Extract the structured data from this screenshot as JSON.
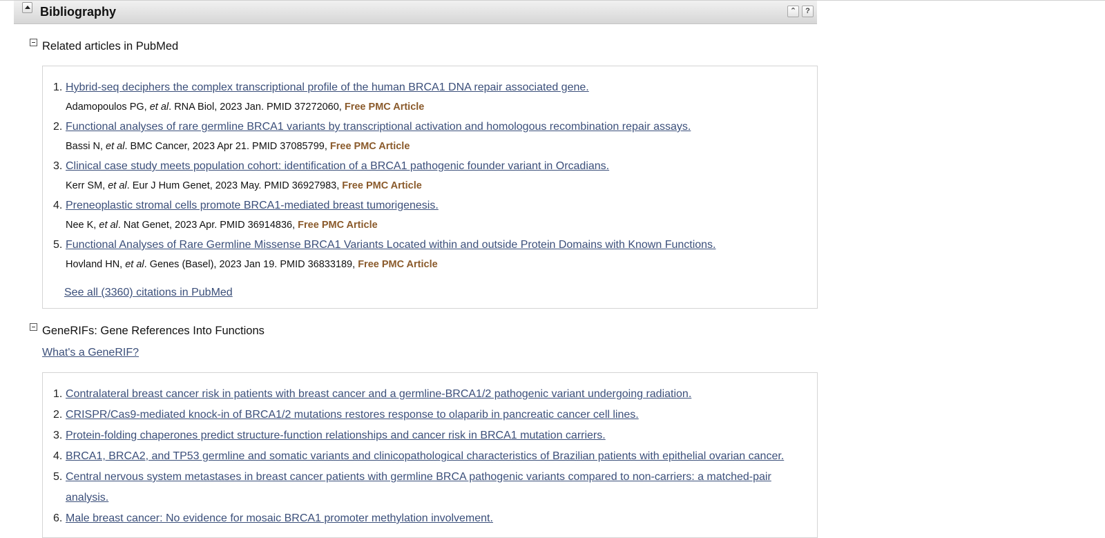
{
  "section": {
    "title": "Bibliography"
  },
  "pubmed": {
    "heading": "Related articles in PubMed",
    "articles": [
      {
        "num": "1.",
        "title": "Hybrid-seq deciphers the complex transcriptional profile of the human BRCA1 DNA repair associated gene.",
        "authors": "Adamopoulos PG,",
        "etal": "et al",
        "journal": ". RNA Biol, 2023 Jan. PMID 37272060,",
        "free": "Free PMC Article"
      },
      {
        "num": "2.",
        "title": "Functional analyses of rare germline BRCA1 variants by transcriptional activation and homologous recombination repair assays.",
        "authors": "Bassi N,",
        "etal": "et al",
        "journal": ". BMC Cancer, 2023 Apr 21. PMID 37085799,",
        "free": "Free PMC Article"
      },
      {
        "num": "3.",
        "title": "Clinical case study meets population cohort: identification of a BRCA1 pathogenic founder variant in Orcadians.",
        "authors": "Kerr SM,",
        "etal": "et al",
        "journal": ". Eur J Hum Genet, 2023 May. PMID 36927983,",
        "free": "Free PMC Article"
      },
      {
        "num": "4.",
        "title": "Preneoplastic stromal cells promote BRCA1-mediated breast tumorigenesis.",
        "authors": "Nee K,",
        "etal": "et al",
        "journal": ". Nat Genet, 2023 Apr. PMID 36914836,",
        "free": "Free PMC Article"
      },
      {
        "num": "5.",
        "title": "Functional Analyses of Rare Germline Missense BRCA1 Variants Located within and outside Protein Domains with Known Functions.",
        "authors": "Hovland HN,",
        "etal": "et al",
        "journal": ". Genes (Basel), 2023 Jan 19. PMID 36833189,",
        "free": "Free PMC Article"
      }
    ],
    "see_all": "See all (3360) citations in PubMed"
  },
  "generifs": {
    "heading": "GeneRIFs: Gene References Into Functions",
    "whats_link": "What's a GeneRIF?",
    "items": [
      {
        "num": "1.",
        "text": "Contralateral breast cancer risk in patients with breast cancer and a germline-BRCA1/2 pathogenic variant undergoing radiation."
      },
      {
        "num": "2.",
        "text": "CRISPR/Cas9-mediated knock-in of BRCA1/2 mutations restores response to olaparib in pancreatic cancer cell lines."
      },
      {
        "num": "3.",
        "text": "Protein-folding chaperones predict structure-function relationships and cancer risk in BRCA1 mutation carriers."
      },
      {
        "num": "4.",
        "text": "BRCA1, BRCA2, and TP53 germline and somatic variants and clinicopathological characteristics of Brazilian patients with epithelial ovarian cancer."
      },
      {
        "num": "5.",
        "text": "Central nervous system metastases in breast cancer patients with germline BRCA pathogenic variants compared to non-carriers: a matched-pair",
        "text_cont": "analysis."
      },
      {
        "num": "6.",
        "text": "Male breast cancer: No evidence for mosaic BRCA1 promoter methylation involvement."
      }
    ]
  }
}
